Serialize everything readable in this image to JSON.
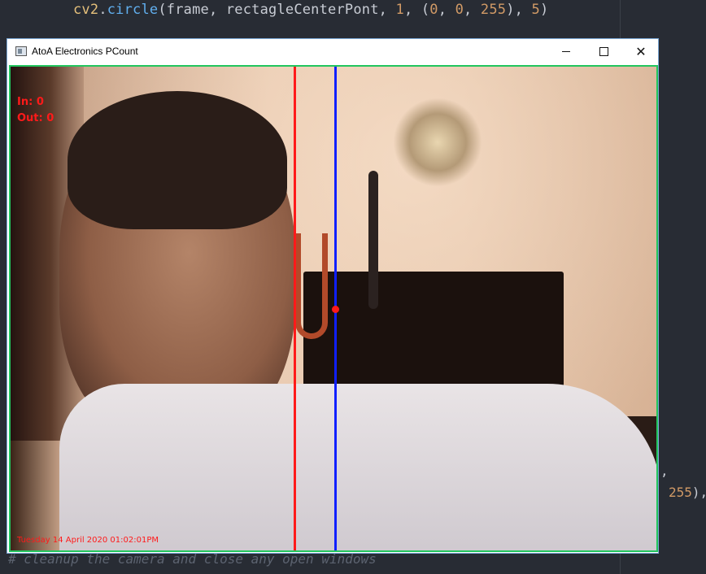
{
  "editor": {
    "line_top": {
      "obj": "cv2",
      "dot": ".",
      "fn": "circle",
      "open": "(frame, rectagleCenterPont, ",
      "n1": "1",
      "mid": ", (",
      "n2": "0",
      "c1": ", ",
      "n3": "0",
      "c2": ", ",
      "n4": "255",
      "mid2": "), ",
      "n5": "5",
      "close": ")"
    },
    "fragment_comma": ",",
    "fragment_255": "255",
    "fragment_255_tail": "),",
    "comment_bottom": "# cleanup the camera and close any open windows"
  },
  "window": {
    "title": "AtoA Electronics PCount",
    "controls": {
      "minimize": "—",
      "maximize": "☐",
      "close": "✕"
    }
  },
  "overlay": {
    "in_label": "In: 0",
    "out_label": "Out: 0",
    "timestamp": "Tuesday 14 April 2020 01:02:01PM",
    "colors": {
      "text": "#ff1a1a",
      "line_red": "#ff1a1a",
      "line_blue": "#1020ff",
      "frame_border": "#22c55e"
    }
  }
}
